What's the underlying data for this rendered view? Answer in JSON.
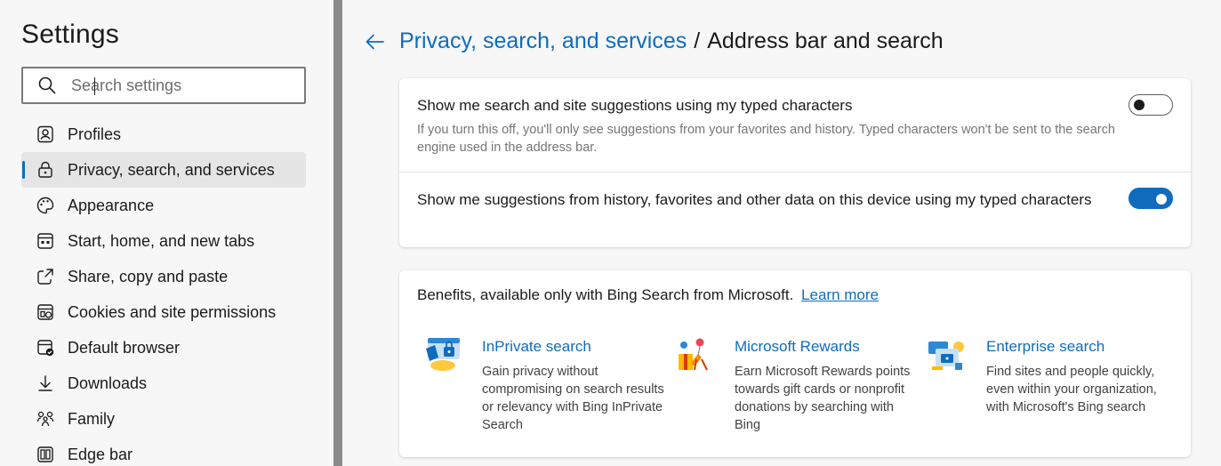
{
  "sidebar": {
    "title": "Settings",
    "search": {
      "placeholder": "Search settings",
      "value": ""
    },
    "items": [
      {
        "label": "Profiles",
        "icon": "profile-icon"
      },
      {
        "label": "Privacy, search, and services",
        "icon": "lock-icon",
        "active": true
      },
      {
        "label": "Appearance",
        "icon": "palette-icon"
      },
      {
        "label": "Start, home, and new tabs",
        "icon": "home-tabs-icon"
      },
      {
        "label": "Share, copy and paste",
        "icon": "share-icon"
      },
      {
        "label": "Cookies and site permissions",
        "icon": "cookies-icon"
      },
      {
        "label": "Default browser",
        "icon": "browser-icon"
      },
      {
        "label": "Downloads",
        "icon": "download-icon"
      },
      {
        "label": "Family",
        "icon": "family-icon"
      },
      {
        "label": "Edge bar",
        "icon": "edge-bar-icon"
      }
    ]
  },
  "breadcrumb": {
    "parent": "Privacy, search, and services",
    "separator": "/",
    "current": "Address bar and search"
  },
  "settings": [
    {
      "title": "Show me search and site suggestions using my typed characters",
      "description": "If you turn this off, you'll only see suggestions from your favorites and history. Typed characters won't be sent to the search engine used in the address bar.",
      "enabled": false
    },
    {
      "title": "Show me suggestions from history, favorites and other data on this device using my typed characters",
      "enabled": true
    }
  ],
  "benefits": {
    "heading": "Benefits, available only with Bing Search from Microsoft.",
    "learn_more": "Learn more",
    "items": [
      {
        "title": "InPrivate search",
        "description": "Gain privacy without compromising on search results or relevancy with Bing InPrivate Search",
        "icon": "inprivate-search-icon"
      },
      {
        "title": "Microsoft Rewards",
        "description": "Earn Microsoft Rewards points towards gift cards or nonprofit donations by searching with Bing",
        "icon": "rewards-icon"
      },
      {
        "title": "Enterprise search",
        "description": "Find sites and people quickly, even within your organization, with Microsoft's Bing search",
        "icon": "enterprise-search-icon"
      }
    ]
  },
  "colors": {
    "accent": "#0f6cbd",
    "sidebar_bg": "#f7f7f7",
    "active_item_bg": "#e5e5e5",
    "divider": "#8a8a8a"
  }
}
